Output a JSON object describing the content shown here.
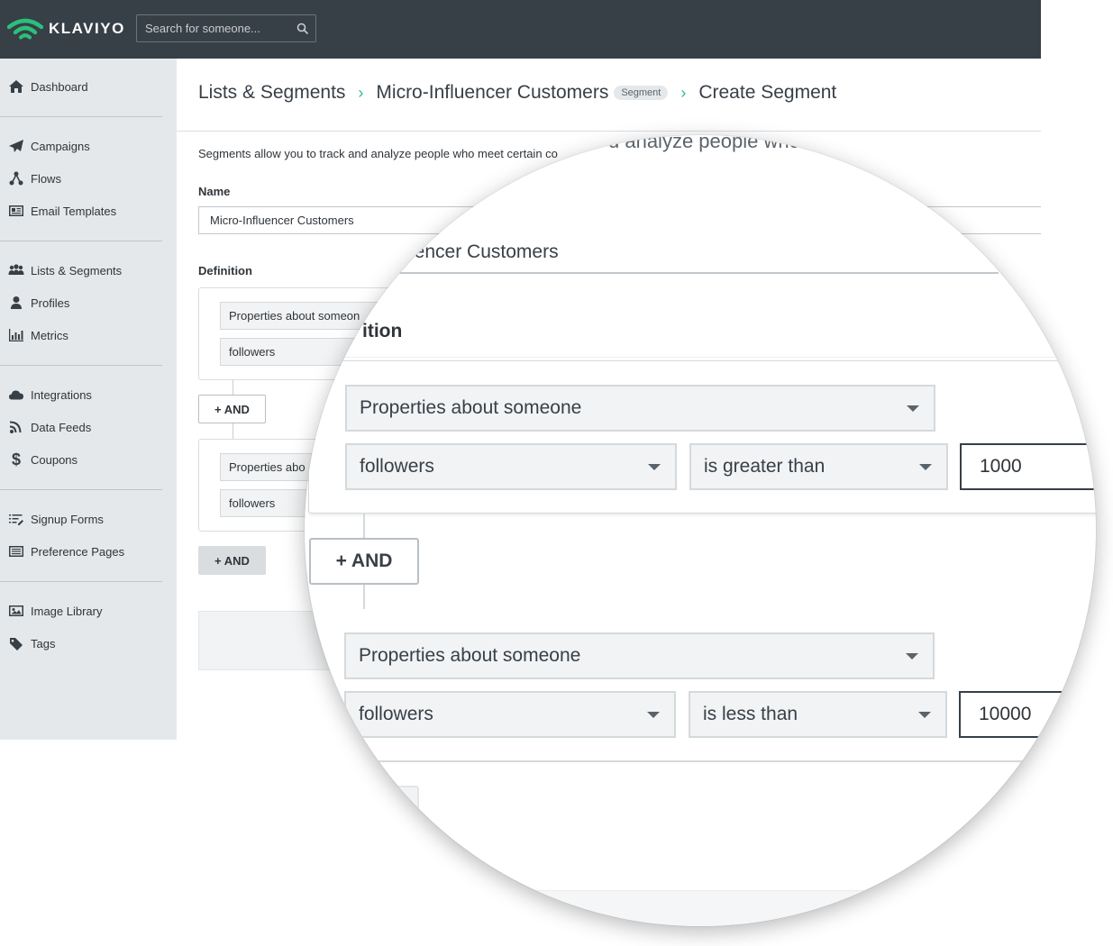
{
  "app": {
    "name": "KLAVIYO",
    "brand_color": "#2bbf7a",
    "topbar_color": "#373f47"
  },
  "search": {
    "placeholder": "Search for someone..."
  },
  "sidebar": {
    "groups": [
      [
        {
          "label": "Dashboard",
          "icon": "home-icon"
        }
      ],
      [
        {
          "label": "Campaigns",
          "icon": "paper-plane-icon"
        },
        {
          "label": "Flows",
          "icon": "flow-icon"
        },
        {
          "label": "Email Templates",
          "icon": "newspaper-icon"
        }
      ],
      [
        {
          "label": "Lists & Segments",
          "icon": "users-icon"
        },
        {
          "label": "Profiles",
          "icon": "user-icon"
        },
        {
          "label": "Metrics",
          "icon": "bar-chart-icon"
        }
      ],
      [
        {
          "label": "Integrations",
          "icon": "cloud-icon"
        },
        {
          "label": "Data Feeds",
          "icon": "rss-icon"
        },
        {
          "label": "Coupons",
          "icon": "dollar-icon"
        }
      ],
      [
        {
          "label": "Signup Forms",
          "icon": "list-edit-icon"
        },
        {
          "label": "Preference Pages",
          "icon": "list-alt-icon"
        }
      ],
      [
        {
          "label": "Image Library",
          "icon": "image-icon"
        },
        {
          "label": "Tags",
          "icon": "tag-icon"
        }
      ]
    ]
  },
  "breadcrumb": {
    "root": "Lists & Segments",
    "parent": "Micro-Influencer Customers",
    "parent_badge": "Segment",
    "current": "Create Segment"
  },
  "main": {
    "description": "Segments allow you to track and analyze people who meet certain co",
    "name_label": "Name",
    "name_value": "Micro-Influencer Customers",
    "definition_label": "Definition",
    "condition1": {
      "type": "Properties about someon",
      "property": "followers"
    },
    "condition2": {
      "type": "Properties abo",
      "property": "followers"
    },
    "and_label": "+ AND"
  },
  "magnified": {
    "description": "d analyze people who m",
    "name_fragment": "uencer Customers",
    "definition_fragment": "ition",
    "condition1": {
      "type": "Properties about someone",
      "property": "followers",
      "operator": "is greater than",
      "value": "1000"
    },
    "condition2": {
      "type": "Properties about someone",
      "property": "followers",
      "operator": "is less than",
      "value": "10000"
    },
    "and_label": "+ AND"
  }
}
